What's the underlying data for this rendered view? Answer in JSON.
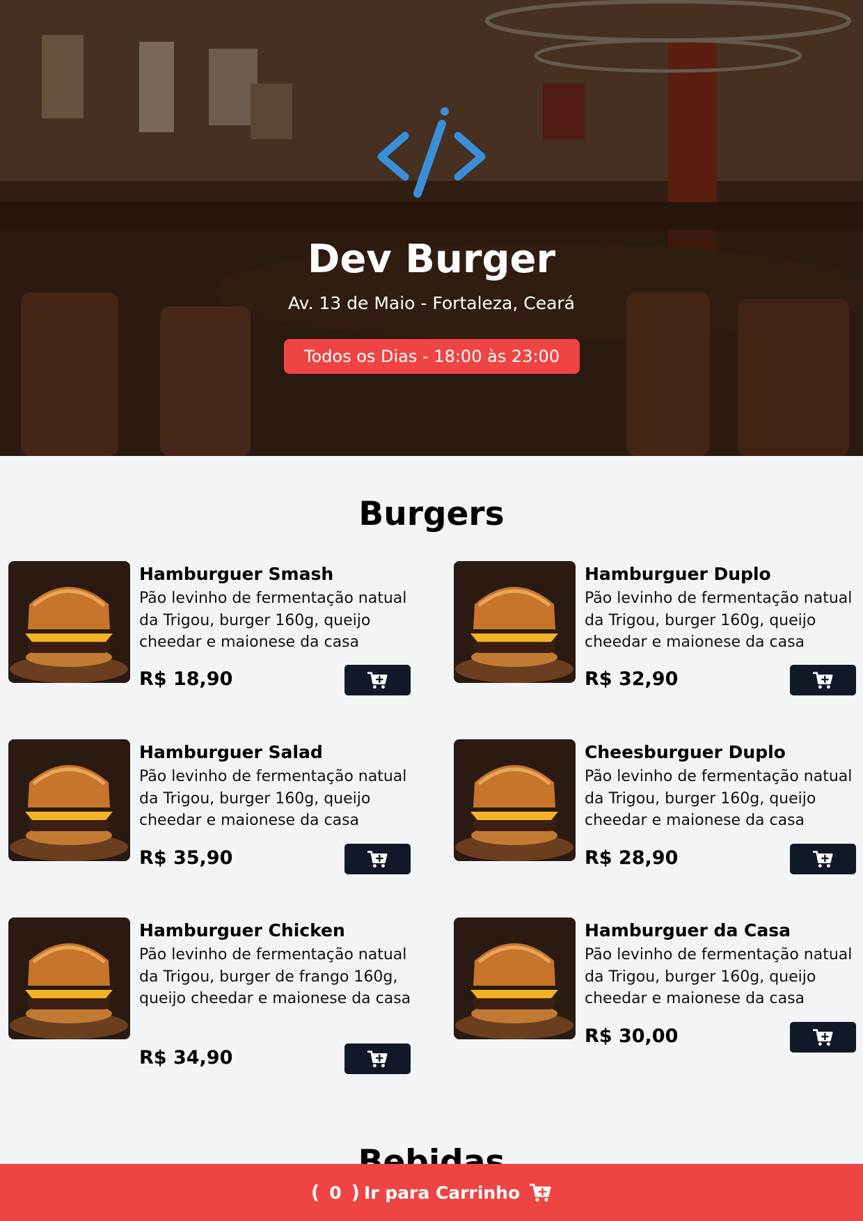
{
  "header": {
    "title": "Dev Burger",
    "address": "Av. 13 de Maio - Fortaleza, Ceará",
    "hours": "Todos os Dias - 18:00 às 23:00",
    "logo_icon": "code-brackets-icon",
    "accent_color": "#ef4444"
  },
  "sections": {
    "burgers": {
      "title": "Burgers",
      "items": [
        {
          "name": "Hamburguer Smash",
          "description": "Pão levinho de fermentação natual da Trigou, burger 160g, queijo cheedar e maionese da casa",
          "price": "R$ 18,90"
        },
        {
          "name": "Hamburguer Duplo",
          "description": "Pão levinho de fermentação natual da Trigou, burger 160g, queijo cheedar e maionese da casa",
          "price": "R$ 32,90"
        },
        {
          "name": "Hamburguer Salad",
          "description": "Pão levinho de fermentação natual da Trigou, burger 160g, queijo cheedar e maionese da casa",
          "price": "R$ 35,90"
        },
        {
          "name": "Cheesburguer Duplo",
          "description": "Pão levinho de fermentação natual da Trigou, burger 160g, queijo cheedar e maionese da casa",
          "price": "R$ 28,90"
        },
        {
          "name": "Hamburguer Chicken",
          "description": "Pão levinho de fermentação natual da Trigou, burger de frango 160g, queijo cheedar e maionese da casa",
          "price": "R$ 34,90"
        },
        {
          "name": "Hamburguer da Casa",
          "description": "Pão levinho de fermentação natual da Trigou, burger 160g, queijo cheedar e maionese da casa",
          "price": "R$ 30,00"
        }
      ]
    },
    "drinks": {
      "title": "Bebidas"
    }
  },
  "cart_bar": {
    "open_paren": "(",
    "count": "0",
    "close_paren": ")",
    "label": "Ir para Carrinho",
    "icon": "cart-plus-icon"
  }
}
